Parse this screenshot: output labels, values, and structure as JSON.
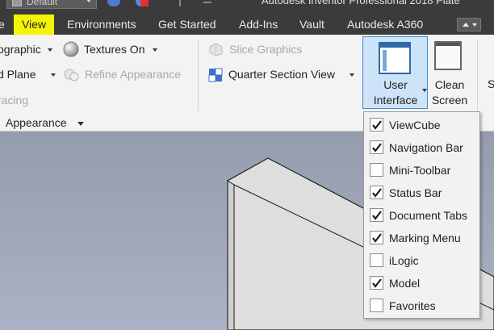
{
  "app": {
    "title": "Autodesk Inventor Professional 2018   Plate",
    "quick_access_combo": "Default"
  },
  "tabs": [
    {
      "label": "View",
      "highlighted": true
    },
    {
      "label": "Environments"
    },
    {
      "label": "Get Started"
    },
    {
      "label": "Add-Ins"
    },
    {
      "label": "Vault"
    },
    {
      "label": "Autodesk A360"
    }
  ],
  "ribbon": {
    "visual_style_label": "ographic",
    "textures_label": "Textures On",
    "ground_plane_label": "d Plane",
    "refine_label": "Refine Appearance",
    "ray_tracing_label": "racing",
    "slice_label": "Slice Graphics",
    "quarter_label": "Quarter Section View",
    "panel_label": "Appearance",
    "user_interface_line1": "User",
    "user_interface_line2": "Interface",
    "clean_screen_line1": "Clean",
    "clean_screen_line2": "Screen",
    "cut_edge_label": "S"
  },
  "dropdown": {
    "items": [
      {
        "label": "ViewCube",
        "checked": true
      },
      {
        "label": "Navigation Bar",
        "checked": true
      },
      {
        "label": "Mini-Toolbar",
        "checked": false
      },
      {
        "label": "Status Bar",
        "checked": true
      },
      {
        "label": "Document Tabs",
        "checked": true
      },
      {
        "label": "Marking Menu",
        "checked": true
      },
      {
        "label": "iLogic",
        "checked": false
      },
      {
        "label": "Model",
        "checked": true,
        "highlighted": true
      },
      {
        "label": "Favorites",
        "checked": false
      }
    ]
  },
  "colors": {
    "highlight": "#f5f30a",
    "tab_bar": "#3b3b3b",
    "ribbon": "#f3f3f3",
    "active_button": "#cde3f7",
    "viewport_top": "#949cae",
    "viewport_bottom": "#aab2c4",
    "model_face": "#dededc"
  },
  "icons": {
    "textures": "sphere-icon",
    "refine": "spheres-icon",
    "slice": "cube-slice-icon",
    "quarter": "quarter-section-icon",
    "user_interface": "window-icon",
    "clean_screen": "window-icon"
  }
}
